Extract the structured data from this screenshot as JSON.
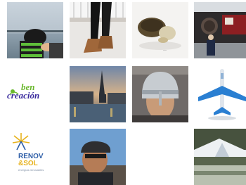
{
  "gallery": {
    "tiles": [
      {
        "alt": "Child in green and black stripes leaning on a railing by the water"
      },
      {
        "alt": "Legs in black tights and brown boots on a white bench"
      },
      {
        "alt": "Turtle-shaped pastry on a white plate"
      },
      {
        "alt": "Man standing in front of a steam locomotive"
      },
      {
        "alt": "ben creación logo"
      },
      {
        "alt": "Church spire and canal at dusk"
      },
      {
        "alt": "Man wearing a silver helmet"
      },
      {
        "alt": "Airplane icon"
      },
      {
        "alt": "RENOV & SOL logo"
      },
      {
        "alt": "Man in a cap, selfie outdoors"
      },
      {
        "alt": "Modern pavilion roof among trees"
      }
    ],
    "logos": {
      "ben_line1": "ben",
      "ben_line2": "creación",
      "renov_line1": "RENOV",
      "renov_line2": "&SOL",
      "renov_tagline": "energías renovables"
    }
  },
  "colors": {
    "ben_green": "#6ab82e",
    "ben_purple": "#3a2a9e",
    "renov_blue": "#2f5fa8",
    "renov_yellow": "#e7b21c",
    "plane_blue": "#2a7fd2"
  }
}
